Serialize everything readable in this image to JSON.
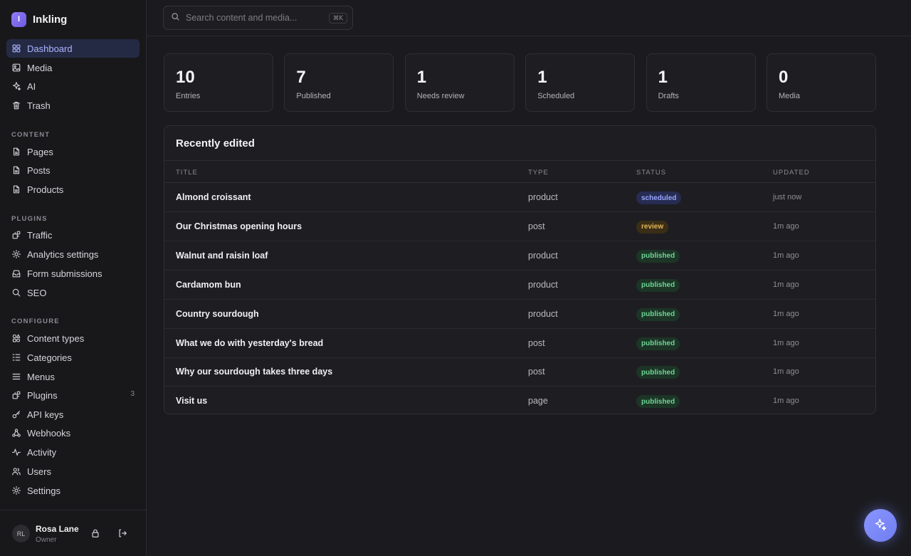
{
  "app": {
    "name": "Inkling",
    "logo_letter": "I"
  },
  "nav_main": [
    {
      "label": "Dashboard",
      "icon": "grid-icon",
      "active": true
    },
    {
      "label": "Media",
      "icon": "image-icon"
    },
    {
      "label": "AI",
      "icon": "sparkles-icon"
    },
    {
      "label": "Trash",
      "icon": "trash-icon"
    }
  ],
  "sections": {
    "content": "CONTENT",
    "plugins": "PLUGINS",
    "configure": "CONFIGURE"
  },
  "nav_content": [
    {
      "label": "Pages",
      "icon": "file-icon"
    },
    {
      "label": "Posts",
      "icon": "file-icon"
    },
    {
      "label": "Products",
      "icon": "file-icon"
    }
  ],
  "nav_plugins": [
    {
      "label": "Traffic",
      "icon": "puzzle-icon"
    },
    {
      "label": "Analytics settings",
      "icon": "gear-icon"
    },
    {
      "label": "Form submissions",
      "icon": "inbox-icon"
    },
    {
      "label": "SEO",
      "icon": "search-icon"
    }
  ],
  "nav_configure": [
    {
      "label": "Content types",
      "icon": "shapes-icon"
    },
    {
      "label": "Categories",
      "icon": "list-tree-icon"
    },
    {
      "label": "Menus",
      "icon": "menu-icon"
    },
    {
      "label": "Plugins",
      "icon": "puzzle-icon",
      "badge": "3"
    },
    {
      "label": "API keys",
      "icon": "key-icon"
    },
    {
      "label": "Webhooks",
      "icon": "webhook-icon"
    },
    {
      "label": "Activity",
      "icon": "activity-icon"
    },
    {
      "label": "Users",
      "icon": "users-icon"
    },
    {
      "label": "Settings",
      "icon": "gear-icon"
    }
  ],
  "user": {
    "initials": "RL",
    "name": "Rosa Lane",
    "role": "Owner"
  },
  "search": {
    "placeholder": "Search content and media...",
    "shortcut": "⌘K"
  },
  "stats": [
    {
      "value": "10",
      "label": "Entries"
    },
    {
      "value": "7",
      "label": "Published"
    },
    {
      "value": "1",
      "label": "Needs review"
    },
    {
      "value": "1",
      "label": "Scheduled"
    },
    {
      "value": "1",
      "label": "Drafts"
    },
    {
      "value": "0",
      "label": "Media"
    }
  ],
  "recent": {
    "title": "Recently edited",
    "columns": {
      "title": "TITLE",
      "type": "TYPE",
      "status": "STATUS",
      "updated": "UPDATED"
    },
    "rows": [
      {
        "title": "Almond croissant",
        "type": "product",
        "status": "scheduled",
        "updated": "just now"
      },
      {
        "title": "Our Christmas opening hours",
        "type": "post",
        "status": "review",
        "updated": "1m ago"
      },
      {
        "title": "Walnut and raisin loaf",
        "type": "product",
        "status": "published",
        "updated": "1m ago"
      },
      {
        "title": "Cardamom bun",
        "type": "product",
        "status": "published",
        "updated": "1m ago"
      },
      {
        "title": "Country sourdough",
        "type": "product",
        "status": "published",
        "updated": "1m ago"
      },
      {
        "title": "What we do with yesterday's bread",
        "type": "post",
        "status": "published",
        "updated": "1m ago"
      },
      {
        "title": "Why our sourdough takes three days",
        "type": "post",
        "status": "published",
        "updated": "1m ago"
      },
      {
        "title": "Visit us",
        "type": "page",
        "status": "published",
        "updated": "1m ago"
      }
    ]
  },
  "status_colors": {
    "scheduled": {
      "bg": "#262c52",
      "fg": "#9aa6ff"
    },
    "review": {
      "bg": "#3a2e16",
      "fg": "#e2b458"
    },
    "published": {
      "bg": "#1c3526",
      "fg": "#6fd495"
    }
  },
  "colors": {
    "accent": "#a9b4ff",
    "active_bg": "#252a44"
  },
  "fab": {
    "icon": "sparkles-icon"
  }
}
